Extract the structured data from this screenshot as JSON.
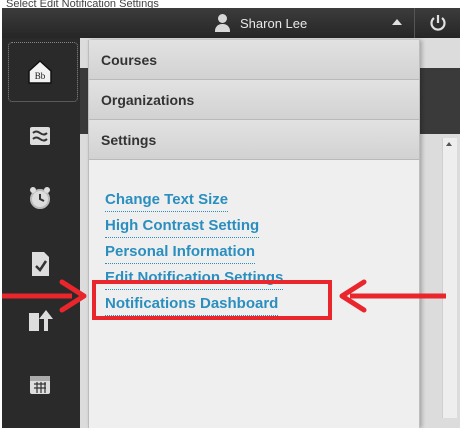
{
  "top_caption": "Select Edit Notification Settings",
  "topbar": {
    "user_name": "Sharon Lee"
  },
  "rail": {
    "icons": [
      "bb-logo-icon",
      "stream-icon",
      "alarm-clock-icon",
      "graded-doc-icon",
      "upload-arrow-icon",
      "calendar-icon"
    ]
  },
  "menu": {
    "headers": [
      "Courses",
      "Organizations",
      "Settings"
    ],
    "settings_links": [
      "Change Text Size",
      "High Contrast Setting",
      "Personal Information",
      "Edit Notification Settings",
      "Notifications Dashboard"
    ]
  },
  "colors": {
    "accent": "#2a8fbf",
    "highlight": "#e8262c"
  }
}
